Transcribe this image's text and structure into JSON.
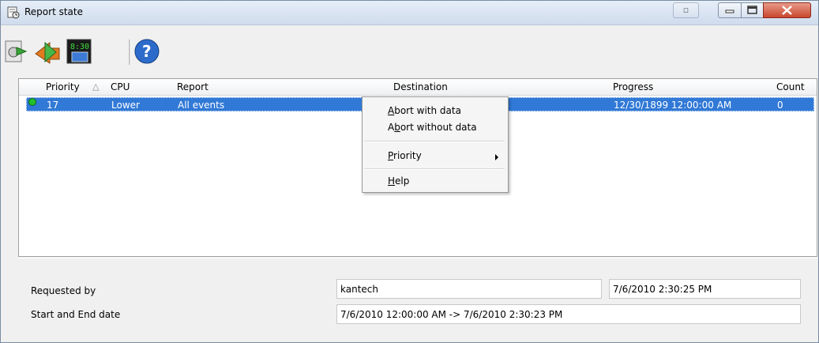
{
  "window": {
    "title": "Report state"
  },
  "toolbar": {
    "buttons": [
      {
        "icon": "send-report-icon"
      },
      {
        "icon": "forward-report-icon"
      },
      {
        "icon": "clock-monitor-icon"
      },
      {
        "icon": "help-icon"
      }
    ]
  },
  "list": {
    "columns": [
      "Priority",
      "CPU",
      "Report",
      "Destination",
      "Progress",
      "Count"
    ],
    "sort_indicator": "△",
    "rows": [
      {
        "priority": "17",
        "cpu": "Lower",
        "report": "All events",
        "destination": "",
        "progress": "12/30/1899 12:00:00 AM",
        "count": "0"
      }
    ]
  },
  "context_menu": {
    "items": [
      "Abort with data",
      "Abort without data",
      "Priority",
      "Help"
    ],
    "abort_with": {
      "accel": "A",
      "rest": "bort with data"
    },
    "abort_without": {
      "pre": "A",
      "accel": "b",
      "rest": "ort without data"
    },
    "priority": {
      "accel": "P",
      "rest": "riority"
    },
    "help": {
      "accel": "H",
      "rest": "elp"
    }
  },
  "details": {
    "requested_by_label": "Requested by",
    "requested_by_value": "kantech",
    "requested_at": "7/6/2010 2:30:25 PM",
    "start_end_label": "Start and End date",
    "start_end_value": "7/6/2010 12:00:00 AM -> 7/6/2010 2:30:23 PM"
  },
  "colors": {
    "selection": "#3179d6",
    "status_ok": "#22c02c",
    "close_button": "#c9462c"
  }
}
